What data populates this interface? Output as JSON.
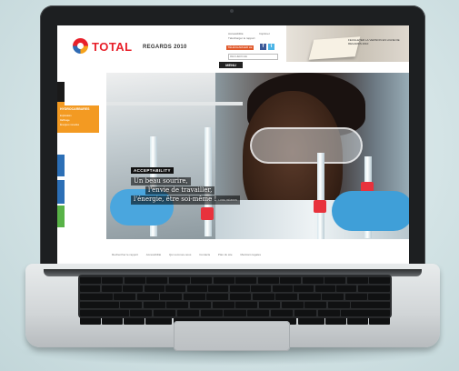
{
  "site": {
    "brand": "TOTAL",
    "subtitle": "REGARDS 2010",
    "menu_label": "MENU",
    "search_placeholder": "RECHERCHE",
    "header_tool_lines": [
      "Accessibilité",
      "Télécharger le rapport",
      "Imprimer"
    ],
    "header_button_label": "TÉLÉCHARGER LE RAPPORT",
    "banner_text": "FEUILLETER LA VERSION EN LIGNE DE REGARDS 2010"
  },
  "sidebar": {
    "active_section": "HYDROCARBURES",
    "active_items": [
      "Exploration",
      "Raffinage",
      "Énergies nouvelles"
    ],
    "tab_colors": [
      "#1a1a1a",
      "#f39a22",
      "#2c6fb6",
      "#2c6fb6",
      "#58b247"
    ]
  },
  "feature": {
    "tag": "ACCEPTABILITY",
    "quote_lines": [
      "Un beau sourire,",
      "l'envie de travailler,",
      "l'énergie, être soi-même !"
    ],
    "credit": "LUCIE, RÉUNION"
  },
  "footer": {
    "links": [
      "Rechercher le rapport",
      "Accessibilité",
      "Qui sommes-nous",
      "Contacts",
      "Plan du site",
      "Mentions légales"
    ]
  },
  "colors": {
    "brand_red": "#e8202a",
    "accent_orange": "#f39a22",
    "accent_blue": "#2c6fb6"
  }
}
